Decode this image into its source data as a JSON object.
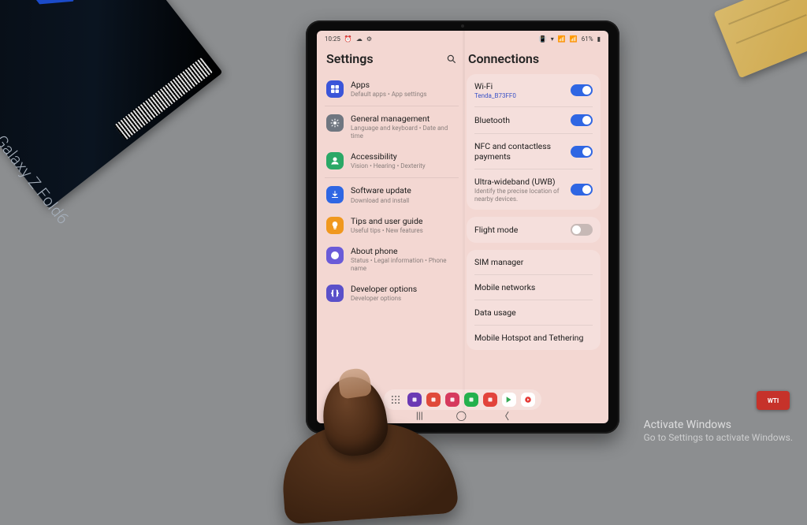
{
  "statusbar": {
    "time": "10:25",
    "battery": "61%"
  },
  "settings": {
    "title": "Settings",
    "items": [
      {
        "title": "Apps",
        "sub": "Default apps • App settings",
        "color": "#3b55d9",
        "icon": "grid"
      },
      {
        "title": "General management",
        "sub": "Language and keyboard • Date and time",
        "color": "#6f7680",
        "icon": "gear"
      },
      {
        "title": "Accessibility",
        "sub": "Vision • Hearing • Dexterity",
        "color": "#2aa866",
        "icon": "person"
      },
      {
        "title": "Software update",
        "sub": "Download and install",
        "color": "#2f66e3",
        "icon": "download"
      },
      {
        "title": "Tips and user guide",
        "sub": "Useful tips • New features",
        "color": "#f0981e",
        "icon": "bulb"
      },
      {
        "title": "About phone",
        "sub": "Status • Legal information • Phone name",
        "color": "#6a5bd8",
        "icon": "info"
      },
      {
        "title": "Developer options",
        "sub": "Developer options",
        "color": "#5a50c9",
        "icon": "braces",
        "obscured": true
      }
    ]
  },
  "connections": {
    "title": "Connections",
    "group1": [
      {
        "title": "Wi-Fi",
        "link": "Tenda_B73FF0",
        "on": true
      },
      {
        "title": "Bluetooth",
        "on": true
      },
      {
        "title": "NFC and contactless payments",
        "on": true
      },
      {
        "title": "Ultra-wideband (UWB)",
        "sub": "Identify the precise location of nearby devices.",
        "on": true
      }
    ],
    "group2": [
      {
        "title": "Flight mode",
        "on": false
      }
    ],
    "group3": [
      {
        "title": "SIM manager"
      },
      {
        "title": "Mobile networks"
      },
      {
        "title": "Data usage"
      },
      {
        "title": "Mobile Hotspot and Tethering"
      }
    ]
  },
  "dock": {
    "apps": [
      {
        "color": "#6a3ab4"
      },
      {
        "color": "#e04a3a"
      },
      {
        "color": "#d63a5e"
      },
      {
        "color": "#23b14d"
      },
      {
        "color": "#e2443c"
      },
      {
        "color": "#ffffff",
        "play": true
      },
      {
        "color": "#ffffff",
        "yt": true
      }
    ]
  },
  "watermark": {
    "l1": "Activate Windows",
    "l2": "Go to Settings to activate Windows."
  },
  "boxtext": "Galaxy Z Fold6"
}
